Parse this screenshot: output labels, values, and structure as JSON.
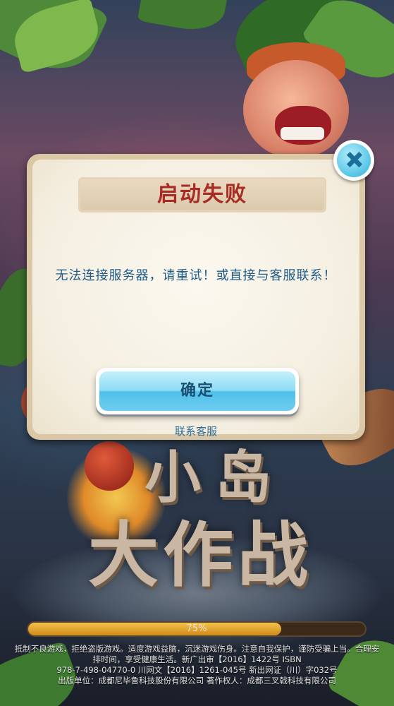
{
  "dialog": {
    "title": "启动失败",
    "message": "无法连接服务器，请重试！或直接与客服联系！",
    "ok_label": "确定",
    "support_label": "联系客服",
    "close_glyph": "✚"
  },
  "background": {
    "logo_line1": "小岛",
    "logo_line2": "大作战"
  },
  "progress": {
    "value": 0.75,
    "label": "75%"
  },
  "legal": {
    "line1": "抵制不良游戏，拒绝盗版游戏。适度游戏益脑，沉迷游戏伤身。注意自我保护，谨防受骗上当。合理安",
    "line2": "排时间，享受健康生活。新广出审【2016】1422号 ISBN",
    "line3": "978-7-498-04770-0 川网文【2016】1261-045号 新出网证（川）字032号",
    "line4": "出版单位：成都尼毕鲁科技股份有限公司 著作权人：成都三叉戟科技有限公司"
  },
  "colors": {
    "title": "#a82b24",
    "message": "#1f5b87",
    "button": "#4fc0ea",
    "progress_fill": "#d08a1c"
  }
}
